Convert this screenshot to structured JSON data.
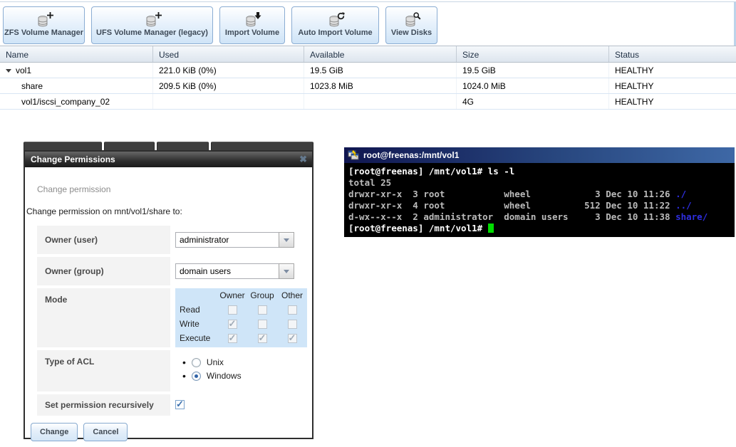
{
  "toolbar": {
    "buttons": [
      {
        "label": "ZFS Volume Manager",
        "icon": "zfs-volume-manager-icon",
        "overlay": "plus"
      },
      {
        "label": "UFS Volume Manager (legacy)",
        "icon": "ufs-volume-manager-icon",
        "overlay": "plus"
      },
      {
        "label": "Import Volume",
        "icon": "import-volume-icon",
        "overlay": "arrow-down"
      },
      {
        "label": "Auto Import Volume",
        "icon": "auto-import-volume-icon",
        "overlay": "refresh"
      },
      {
        "label": "View Disks",
        "icon": "view-disks-icon",
        "overlay": "magnifier"
      }
    ]
  },
  "volumes_table": {
    "columns": [
      "Name",
      "Used",
      "Available",
      "Size",
      "Status"
    ],
    "rows": [
      {
        "name": "vol1",
        "expanded": true,
        "used": "221.0 KiB (0%)",
        "available": "19.5 GiB",
        "size": "19.5 GiB",
        "status": "HEALTHY"
      },
      {
        "name": "share",
        "used": "209.5 KiB (0%)",
        "available": "1023.8 MiB",
        "size": "1024.0 MiB",
        "status": "HEALTHY"
      },
      {
        "name": "vol1/iscsi_company_02",
        "used": "",
        "available": "",
        "size": "4G",
        "status": "HEALTHY"
      }
    ]
  },
  "dialog": {
    "title": "Change Permissions",
    "close_icon": "✖",
    "subtitle": "Change permission",
    "description": "Change permission on mnt/vol1/share to:",
    "fields": {
      "owner_user": {
        "label": "Owner (user)",
        "value": "administrator"
      },
      "owner_group": {
        "label": "Owner (group)",
        "value": "domain users"
      },
      "mode": {
        "label": "Mode",
        "columns": [
          "Owner",
          "Group",
          "Other"
        ],
        "rows": [
          {
            "label": "Read",
            "states": [
              false,
              false,
              false
            ]
          },
          {
            "label": "Write",
            "states": [
              true,
              false,
              false
            ]
          },
          {
            "label": "Execute",
            "states": [
              true,
              true,
              true
            ]
          }
        ]
      },
      "acl": {
        "label": "Type of ACL",
        "options": [
          {
            "label": "Unix",
            "selected": false
          },
          {
            "label": "Windows",
            "selected": true
          }
        ]
      },
      "recursive": {
        "label": "Set permission recursively",
        "checked": true
      }
    },
    "buttons": {
      "change": "Change",
      "cancel": "Cancel"
    }
  },
  "terminal": {
    "title": "root@freenas:/mnt/vol1",
    "lines": [
      {
        "text": "[root@freenas] /mnt/vol1# ls -l"
      },
      {
        "text": "total 25"
      },
      {
        "text": "drwxr-xr-x  3 root           wheel            3 Dec 10 11:26 ",
        "dir": "./"
      },
      {
        "text": "drwxr-xr-x  4 root           wheel          512 Dec 10 11:22 ",
        "dir": "../"
      },
      {
        "text": "d-wx--x--x  2 administrator  domain users     3 Dec 10 11:38 ",
        "dir": "share/"
      },
      {
        "text": "[root@freenas] /mnt/vol1# ",
        "cursor": true
      }
    ]
  }
}
